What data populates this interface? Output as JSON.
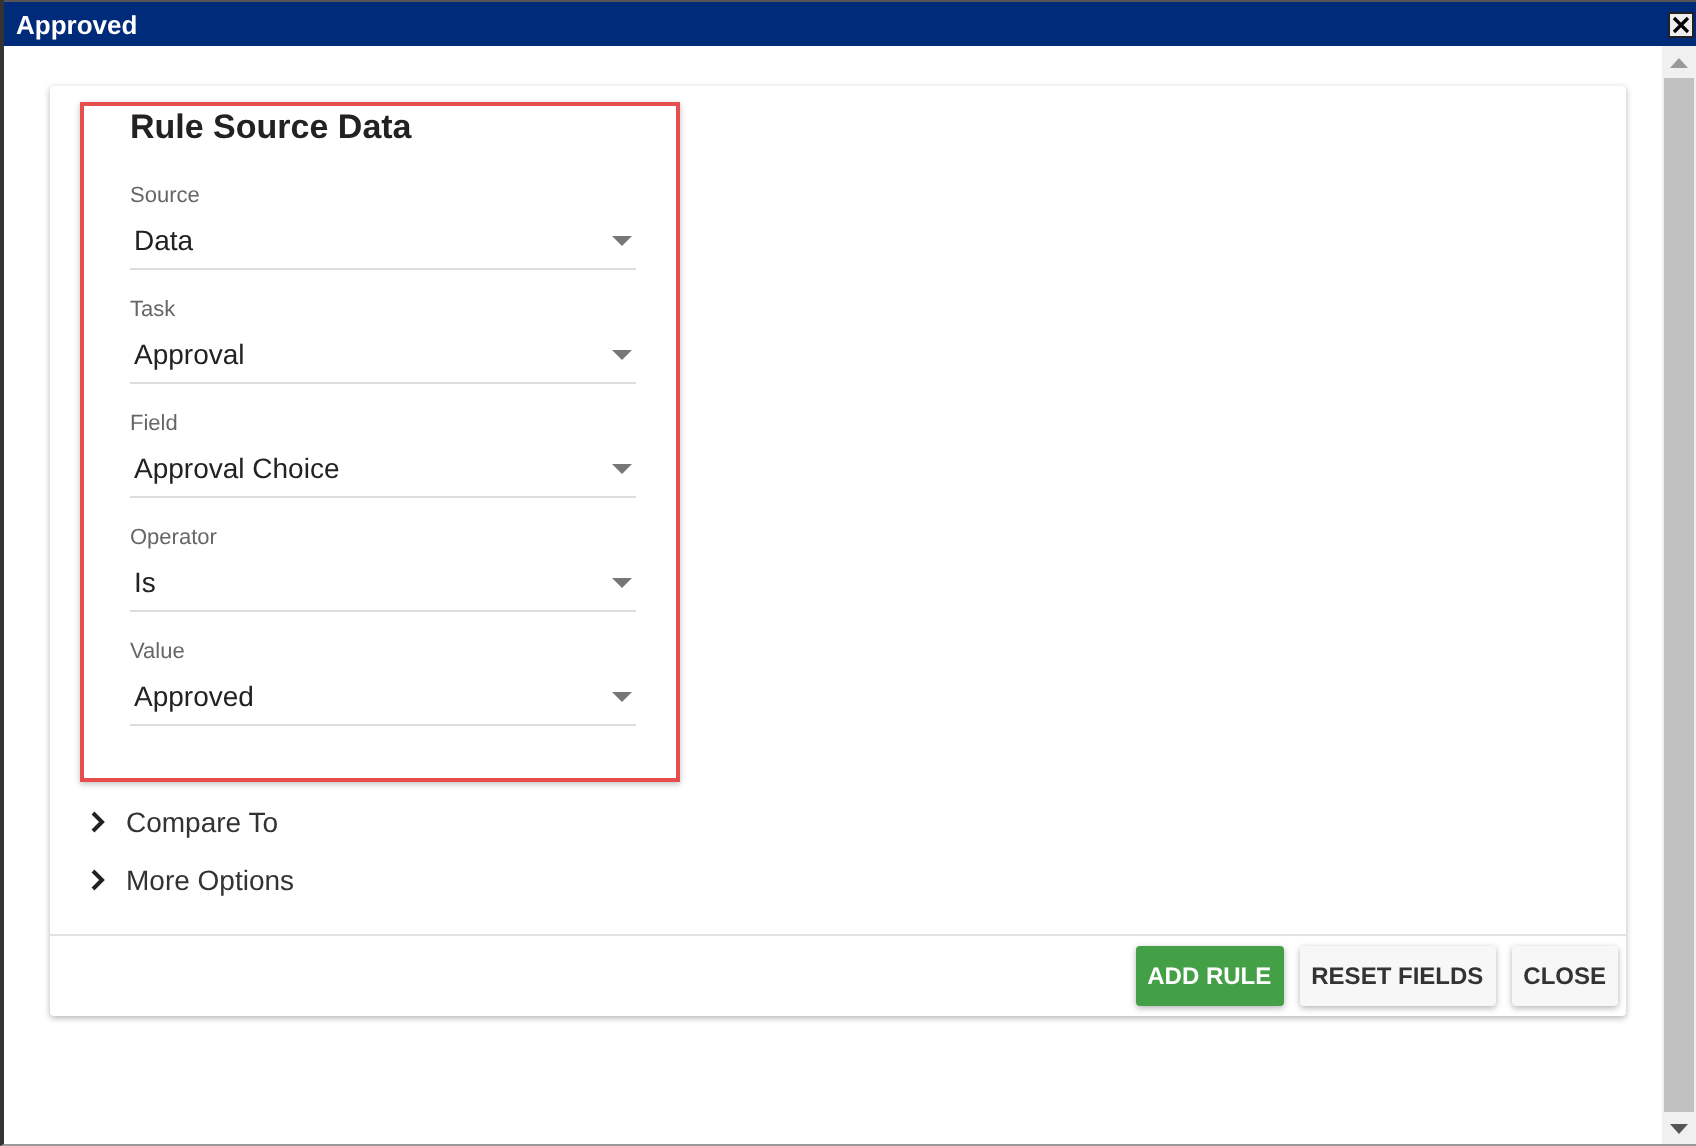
{
  "window": {
    "title": "Approved"
  },
  "section": {
    "title": "Rule Source Data",
    "fields": [
      {
        "label": "Source",
        "value": "Data"
      },
      {
        "label": "Task",
        "value": "Approval"
      },
      {
        "label": "Field",
        "value": "Approval Choice"
      },
      {
        "label": "Operator",
        "value": "Is"
      },
      {
        "label": "Value",
        "value": "Approved"
      }
    ]
  },
  "expanders": [
    {
      "label": "Compare To",
      "expanded": false
    },
    {
      "label": "More Options",
      "expanded": false
    }
  ],
  "buttons": [
    {
      "label": "ADD RULE",
      "kind": "primary"
    },
    {
      "label": "RESET FIELDS",
      "kind": "plain"
    },
    {
      "label": "CLOSE",
      "kind": "plain"
    }
  ]
}
